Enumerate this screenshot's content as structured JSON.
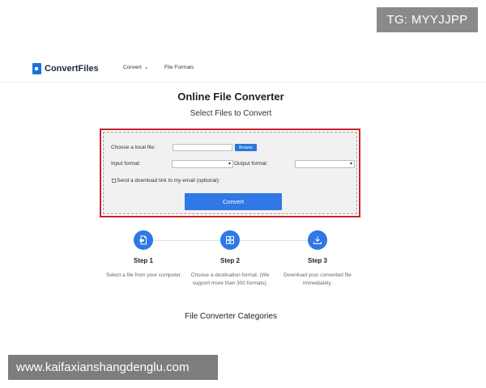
{
  "watermarks": {
    "top": "TG: MYYJJPP",
    "bottom": "www.kaifaxianshangdenglu.com"
  },
  "header": {
    "logo_text": "ConvertFiles",
    "nav": [
      {
        "label": "Convert",
        "has_caret": true
      },
      {
        "label": "File Formats"
      }
    ]
  },
  "main": {
    "title": "Online File Converter",
    "subtitle": "Select Files to Convert"
  },
  "converter": {
    "local_file_label": "Choose a local file:",
    "browse_label": "Browse",
    "input_format_label": "Input format:",
    "output_format_label": "Output format:",
    "input_format_value": "",
    "output_format_value": "",
    "email_label": "Send a download link to my email (optional):",
    "email_checked": false,
    "convert_label": "Convert"
  },
  "steps": [
    {
      "title": "Step 1",
      "desc": "Select a file from your computer",
      "icon": "file-icon"
    },
    {
      "title": "Step 2",
      "desc": "Choose a destination format. (We support more than 300 formats).",
      "icon": "grid-icon"
    },
    {
      "title": "Step 3",
      "desc": "Download your converted file immediately.",
      "icon": "download-icon"
    }
  ],
  "categories_title": "File Converter Categories",
  "colors": {
    "accent": "#2f78e5",
    "highlight_border": "#c8232c",
    "panel_bg": "#f1f1f1"
  }
}
